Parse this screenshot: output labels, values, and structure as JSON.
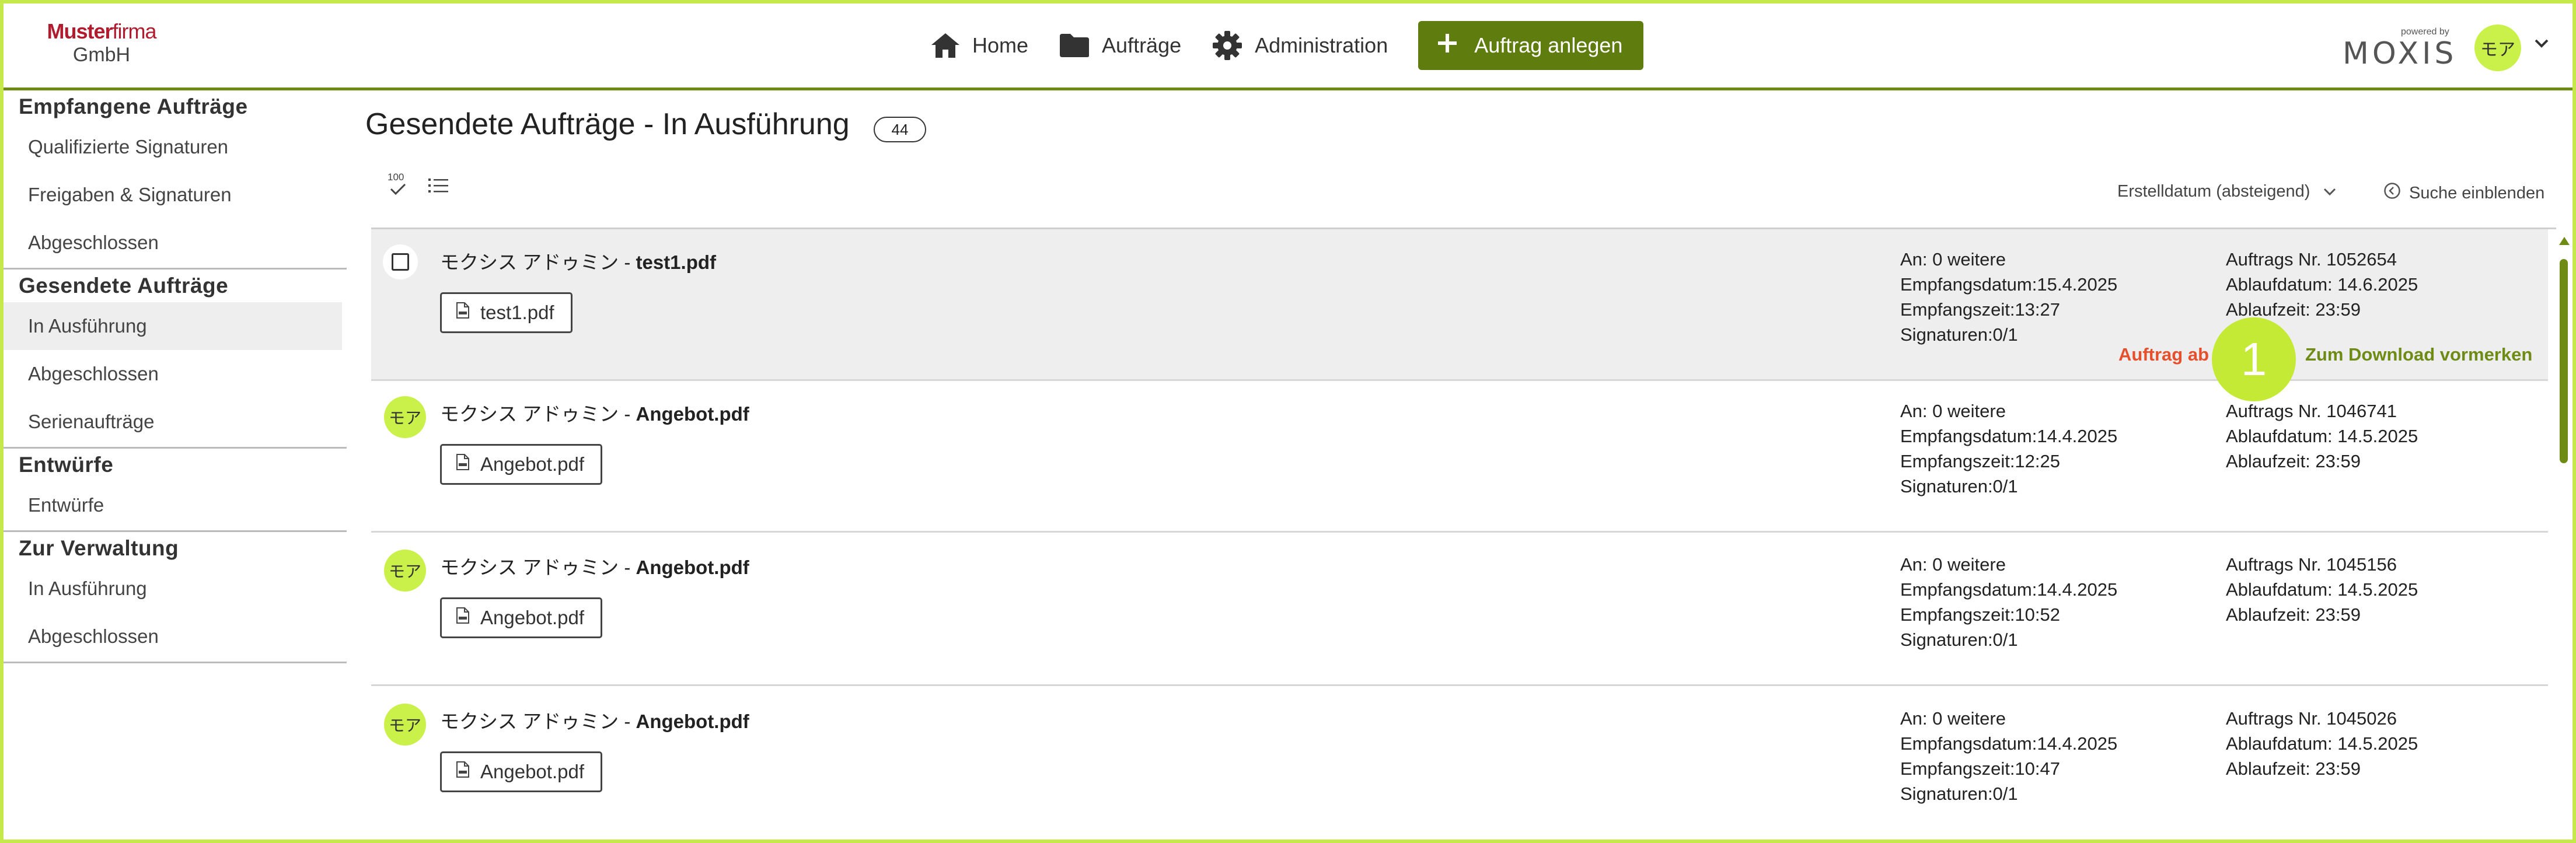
{
  "brand": {
    "line1_bold": "Muster",
    "line1_rest": "firma",
    "line2": "GmbH"
  },
  "nav": {
    "home": "Home",
    "orders": "Aufträge",
    "admin": "Administration",
    "create": "Auftrag anlegen"
  },
  "moxis": {
    "powered": "powered by",
    "logo": "MOXIS"
  },
  "user": {
    "initials": "モア"
  },
  "sidebar": {
    "received_title": "Empfangene Aufträge",
    "received_items": [
      "Qualifizierte Signaturen",
      "Freigaben & Signaturen",
      "Abgeschlossen"
    ],
    "sent_title": "Gesendete Aufträge",
    "sent_items": [
      "In Ausführung",
      "Abgeschlossen",
      "Serienaufträge"
    ],
    "drafts_title": "Entwürfe",
    "drafts_items": [
      "Entwürfe"
    ],
    "admin_title": "Zur Verwaltung",
    "admin_items": [
      "In Ausführung",
      "Abgeschlossen"
    ]
  },
  "main": {
    "title": "Gesendete Aufträge - In Ausführung",
    "count": "44",
    "select_count": "100",
    "sort_label": "Erstelldatum (absteigend)",
    "search_toggle": "Suche einblenden"
  },
  "rows": [
    {
      "sender": "モクシス アドゥミン",
      "sep": " - ",
      "doc": "test1.pdf",
      "file": "test1.pdf",
      "to": "An: 0 weitere",
      "received_date": "Empfangsdatum:15.4.2025",
      "received_time": "Empfangszeit:13:27",
      "signatures": "Signaturen:0/1",
      "order_no": "Auftrags Nr. 1052654",
      "expiry_date": "Ablaufdatum: 14.6.2025",
      "expiry_time": "Ablaufzeit: 23:59",
      "action_cancel": "Auftrag ab",
      "action_download": "Zum Download vormerken"
    },
    {
      "sender": "モクシス アドゥミン",
      "sep": " - ",
      "doc": "Angebot.pdf",
      "file": "Angebot.pdf",
      "to": "An: 0 weitere",
      "received_date": "Empfangsdatum:14.4.2025",
      "received_time": "Empfangszeit:12:25",
      "signatures": "Signaturen:0/1",
      "order_no": "Auftrags Nr. 1046741",
      "expiry_date": "Ablaufdatum: 14.5.2025",
      "expiry_time": "Ablaufzeit: 23:59"
    },
    {
      "sender": "モクシス アドゥミン",
      "sep": " - ",
      "doc": "Angebot.pdf",
      "file": "Angebot.pdf",
      "to": "An: 0 weitere",
      "received_date": "Empfangsdatum:14.4.2025",
      "received_time": "Empfangszeit:10:52",
      "signatures": "Signaturen:0/1",
      "order_no": "Auftrags Nr. 1045156",
      "expiry_date": "Ablaufdatum: 14.5.2025",
      "expiry_time": "Ablaufzeit: 23:59"
    },
    {
      "sender": "モクシス アドゥミン",
      "sep": " - ",
      "doc": "Angebot.pdf",
      "file": "Angebot.pdf",
      "to": "An: 0 weitere",
      "received_date": "Empfangsdatum:14.4.2025",
      "received_time": "Empfangszeit:10:47",
      "signatures": "Signaturen:0/1",
      "order_no": "Auftrags Nr. 1045026",
      "expiry_date": "Ablaufdatum: 14.5.2025",
      "expiry_time": "Ablaufzeit: 23:59"
    }
  ],
  "annotation": {
    "marker": "1"
  },
  "colors": {
    "accent": "#5f7d0f",
    "highlight": "#c5e94a",
    "danger": "#e5502c",
    "brand_red": "#b01b2e"
  },
  "icons": [
    "home-icon",
    "folder-icon",
    "gear-icon",
    "plus-icon",
    "chevron-down-icon",
    "select-all-icon",
    "list-icon",
    "circle-chevron-left-icon",
    "pdf-file-icon"
  ]
}
